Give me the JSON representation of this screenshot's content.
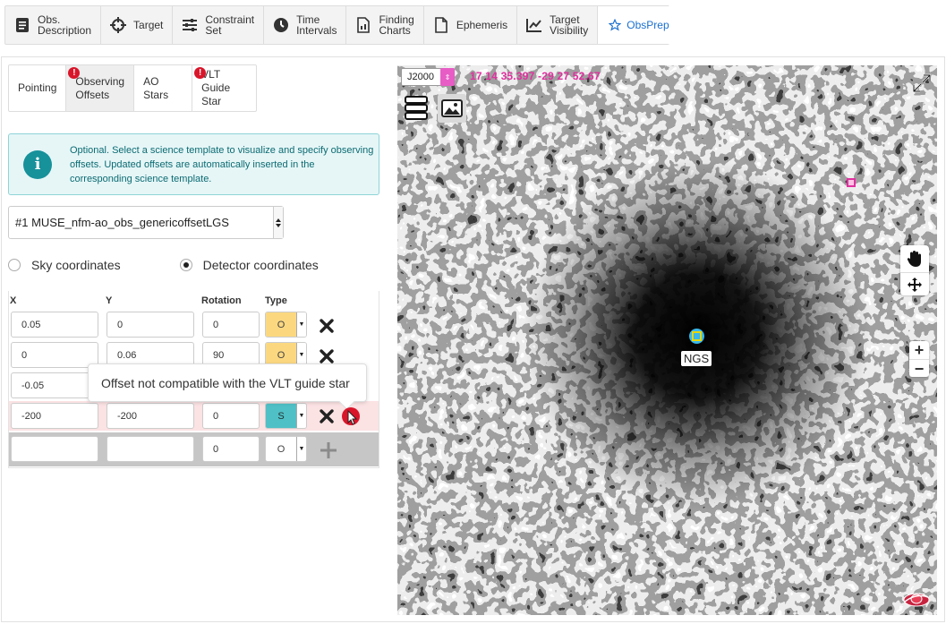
{
  "top_tabs": [
    {
      "label_lines": [
        "Obs.",
        "Description"
      ],
      "icon": "document-list-icon"
    },
    {
      "label_lines": [
        "Target"
      ],
      "icon": "crosshair-icon"
    },
    {
      "label_lines": [
        "Constraint",
        "Set"
      ],
      "icon": "sliders-icon"
    },
    {
      "label_lines": [
        "Time",
        "Intervals"
      ],
      "icon": "clock-icon"
    },
    {
      "label_lines": [
        "Finding",
        "Charts"
      ],
      "icon": "chart-file-icon"
    },
    {
      "label_lines": [
        "Ephemeris"
      ],
      "icon": "file-icon"
    },
    {
      "label_lines": [
        "Target",
        "Visibility"
      ],
      "icon": "line-chart-icon"
    },
    {
      "label_lines": [
        "ObsPrep"
      ],
      "icon": "star-icon",
      "active": true
    }
  ],
  "sub_tabs": [
    {
      "label_lines": [
        "Pointing"
      ],
      "warning": false
    },
    {
      "label_lines": [
        "Observing",
        "Offsets"
      ],
      "warning": true,
      "active": true
    },
    {
      "label_lines": [
        "AO Stars"
      ],
      "warning": false
    },
    {
      "label_lines": [
        "VLT Guide",
        "Star"
      ],
      "warning": true
    }
  ],
  "warning_symbol": "!",
  "info": {
    "icon": "info-icon",
    "glyph": "i",
    "text": "Optional. Select a science template to visualize and specify observing offsets. Updated offsets are automatically inserted in the corresponding science template."
  },
  "template_select": {
    "value": "#1 MUSE_nfm-ao_obs_genericoffsetLGS"
  },
  "coordinates": {
    "sky_label": "Sky coordinates",
    "detector_label": "Detector coordinates",
    "selected": "detector"
  },
  "offsets_table": {
    "headers": {
      "x": "X",
      "y": "Y",
      "rotation": "Rotation",
      "type": "Type"
    },
    "rows": [
      {
        "x": "0.05",
        "y": "0",
        "rotation": "0",
        "type": "O",
        "error": false
      },
      {
        "x": "0",
        "y": "0.06",
        "rotation": "90",
        "type": "O",
        "error": false
      },
      {
        "x": "-0.05",
        "y": "",
        "rotation": "",
        "type": "",
        "error": false,
        "hidden_by_tooltip": true
      },
      {
        "x": "-200",
        "y": "-200",
        "rotation": "0",
        "type": "S",
        "error": true
      }
    ],
    "new_row": {
      "x": "",
      "y": "",
      "rotation": "0",
      "type": "O"
    }
  },
  "tooltip": {
    "text": "Offset not compatible with the VLT guide star"
  },
  "viewer": {
    "frame": "J2000",
    "coords": "17 14 35.397 -29 27 52.67",
    "target_label": "NGS",
    "colors": {
      "coords": "#e0309f",
      "target": "#39b7ea",
      "accent": "#1a6fd0",
      "error": "#d9152a"
    }
  }
}
